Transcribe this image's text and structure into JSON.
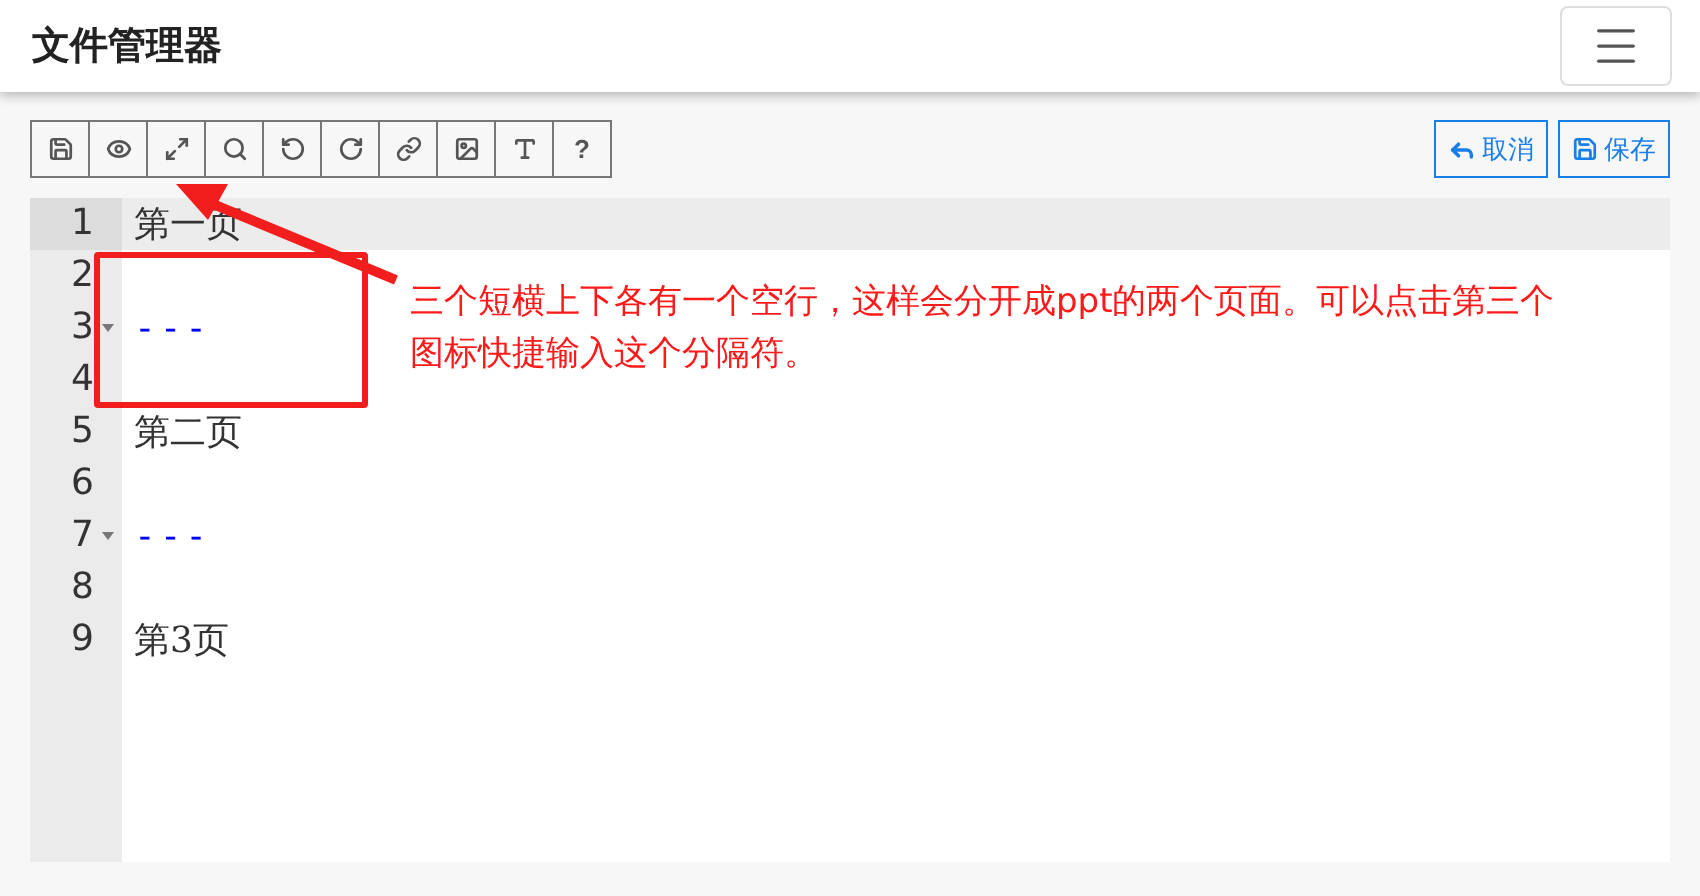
{
  "header": {
    "title": "文件管理器"
  },
  "toolbar": {
    "help_label": "?"
  },
  "actions": [
    {
      "kind": "cancel",
      "label": "取消"
    },
    {
      "kind": "save",
      "label": "保存"
    }
  ],
  "editor": {
    "lines": [
      {
        "number": "1",
        "kind": "text",
        "text": "第一页",
        "active": true,
        "foldable": false
      },
      {
        "number": "2",
        "kind": "blank",
        "active": false,
        "foldable": false
      },
      {
        "number": "3",
        "kind": "rule",
        "text": "---",
        "active": false,
        "foldable": true
      },
      {
        "number": "4",
        "kind": "blank",
        "active": false,
        "foldable": false
      },
      {
        "number": "5",
        "kind": "text",
        "text": "第二页",
        "active": false,
        "foldable": false
      },
      {
        "number": "6",
        "kind": "blank",
        "active": false,
        "foldable": false
      },
      {
        "number": "7",
        "kind": "rule",
        "text": "---",
        "active": false,
        "foldable": true
      },
      {
        "number": "8",
        "kind": "blank",
        "active": false,
        "foldable": false
      },
      {
        "number": "9",
        "kind": "text",
        "text": "第3页",
        "active": false,
        "foldable": false
      }
    ]
  },
  "annotation": {
    "text": "三个短横上下各有一个空行，这样会分开成ppt的两个页面。可以点击第三个图标快捷输入这个分隔符。"
  }
}
